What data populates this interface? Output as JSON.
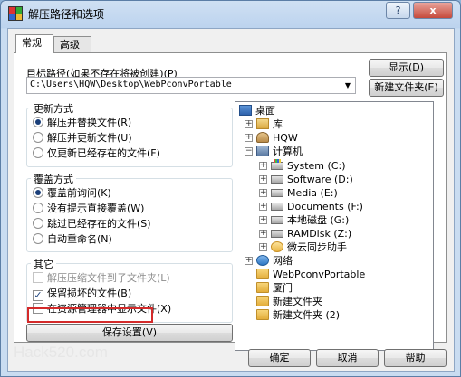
{
  "window": {
    "title": "解压路径和选项",
    "help_glyph": "?",
    "close_glyph": "x"
  },
  "tabs": [
    "常规",
    "高级"
  ],
  "target": {
    "label": "目标路径(如果不存在将被创建)(P)",
    "path": "C:\\Users\\HQW\\Desktop\\WebPconvPortable",
    "show_button": "显示(D)",
    "new_folder_button": "新建文件夹(E)"
  },
  "update_mode": {
    "title": "更新方式",
    "options": [
      {
        "label": "解压并替换文件(R)",
        "selected": true
      },
      {
        "label": "解压并更新文件(U)",
        "selected": false
      },
      {
        "label": "仅更新已经存在的文件(F)",
        "selected": false
      }
    ]
  },
  "overwrite_mode": {
    "title": "覆盖方式",
    "options": [
      {
        "label": "覆盖前询问(K)",
        "selected": true
      },
      {
        "label": "没有提示直接覆盖(W)",
        "selected": false
      },
      {
        "label": "跳过已经存在的文件(S)",
        "selected": false
      },
      {
        "label": "自动重命名(N)",
        "selected": false
      }
    ]
  },
  "misc": {
    "title": "其它",
    "options": [
      {
        "label": "解压压缩文件到子文件夹(L)",
        "checked": false,
        "disabled": true
      },
      {
        "label": "保留损坏的文件(B)",
        "checked": true,
        "disabled": false
      },
      {
        "label": "在资源管理器中显示文件(X)",
        "checked": false,
        "disabled": false
      }
    ]
  },
  "save_button": "保存设置(V)",
  "tree": {
    "desktop": "桌面",
    "library": "库",
    "user": "HQW",
    "computer": "计算机",
    "drives": [
      "System (C:)",
      "Software (D:)",
      "Media (E:)",
      "Documents (F:)",
      "本地磁盘 (G:)",
      "RAMDisk (Z:)",
      "微云同步助手"
    ],
    "network": "网络",
    "folders": [
      "WebPconvPortable",
      "厦门",
      "新建文件夹",
      "新建文件夹 (2)"
    ]
  },
  "footer": {
    "watermark": "Hack520.com",
    "ok_button": "确定",
    "cancel_button": "取消",
    "help_button": "帮助"
  }
}
